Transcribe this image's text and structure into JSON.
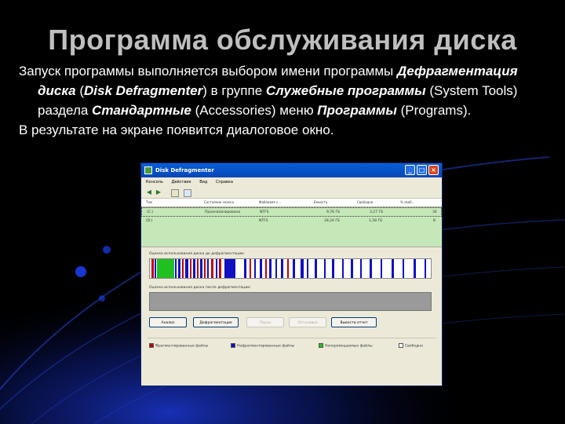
{
  "slide": {
    "title": "Программа обслуживания диска",
    "p1_a": "Запуск программы выполняется выбором имени программы ",
    "p1_b": "Дефрагментация диска",
    "p1_c": " (",
    "p1_d": "Disk Defragmenter",
    "p1_e": ") в группе ",
    "p1_f": "Служебные программы",
    "p1_g": " (System Tools) раздела ",
    "p1_h": "Стандартные",
    "p1_i": " (Accessories) меню ",
    "p1_j": "Программы",
    "p1_k": " (Programs).",
    "p2": "В результате на экране появится диалоговое окно."
  },
  "window": {
    "title": "Disk Defragmenter",
    "menu": [
      "Консоль",
      "Действие",
      "Вид",
      "Справка"
    ],
    "columns": [
      "Том",
      "Состояние сеанса",
      "Файловая с...",
      "Емкость",
      "Свободно",
      "% своб..."
    ],
    "volumes": [
      {
        "name": "(C:)",
        "status": "Проанализировано",
        "fs": "NTFS",
        "capacity": "9,76 ГБ",
        "free": "3,27 ГБ",
        "pct": "34"
      },
      {
        "name": "(D:)",
        "status": "",
        "fs": "NTFS",
        "capacity": "18,24 ГБ",
        "free": "1,58 ГБ",
        "pct": "8"
      }
    ],
    "analysis_label": "Оценка использования диска до дефрагментации:",
    "defrag_label": "Оценка использования диска после дефрагментации:",
    "buttons": [
      "Анализ",
      "Дефрагментация",
      "Пауза",
      "Остановка",
      "Вывести отчет"
    ],
    "legend": [
      {
        "label": "Фрагментированные файлы",
        "color": "#c00000"
      },
      {
        "label": "Нефрагментированные файлы",
        "color": "#1010c0"
      },
      {
        "label": "Неперемещаемые файлы",
        "color": "#20c020"
      },
      {
        "label": "Свободно",
        "color": "#ffffff"
      }
    ],
    "title_buttons": [
      "_",
      "□",
      "×"
    ]
  },
  "colors": {
    "title": "#bfbfbf",
    "text": "#ffffff",
    "background": "#000000",
    "accent": "#1e3fb0"
  }
}
